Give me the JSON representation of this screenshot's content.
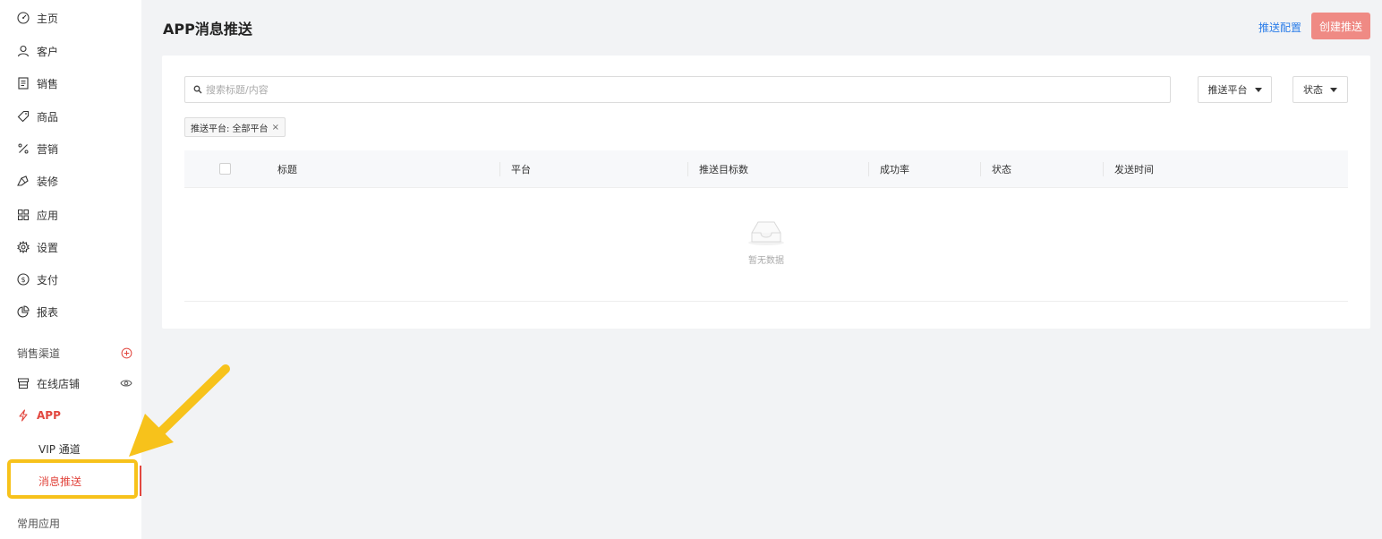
{
  "sidebar": {
    "items": [
      {
        "label": "主页",
        "icon": "dashboard-icon"
      },
      {
        "label": "客户",
        "icon": "user-icon"
      },
      {
        "label": "销售",
        "icon": "document-icon"
      },
      {
        "label": "商品",
        "icon": "tag-icon"
      },
      {
        "label": "营销",
        "icon": "percent-icon"
      },
      {
        "label": "装修",
        "icon": "brush-icon"
      },
      {
        "label": "应用",
        "icon": "grid-icon"
      },
      {
        "label": "设置",
        "icon": "gear-icon"
      },
      {
        "label": "支付",
        "icon": "dollar-icon"
      },
      {
        "label": "报表",
        "icon": "pie-chart-icon"
      }
    ],
    "channels_label": "销售渠道",
    "online_store_label": "在线店铺",
    "app_label": "APP",
    "sub_items": [
      {
        "label": "VIP 通道"
      },
      {
        "label": "消息推送"
      }
    ],
    "common_apps_label": "常用应用",
    "accent_color": "#e2473f"
  },
  "header": {
    "title": "APP消息推送",
    "config_link": "推送配置",
    "create_button": "创建推送"
  },
  "filters": {
    "search_placeholder": "搜索标题/内容",
    "platform_dropdown": "推送平台",
    "status_dropdown": "状态",
    "active_tag": "推送平台: 全部平台"
  },
  "table": {
    "columns": [
      "标题",
      "平台",
      "推送目标数",
      "成功率",
      "状态",
      "发送时间"
    ],
    "empty_text": "暂无数据"
  }
}
